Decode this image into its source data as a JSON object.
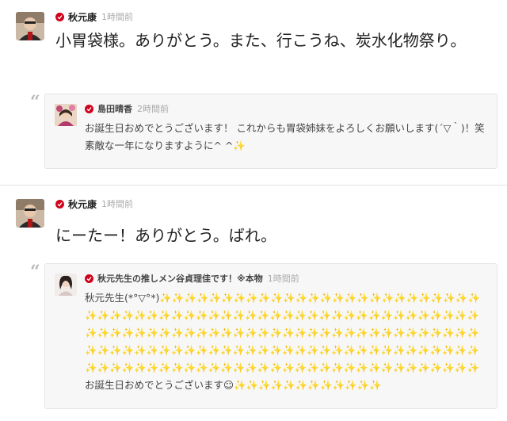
{
  "posts": [
    {
      "author": "秋元康",
      "time": "1時間前",
      "text": "小胃袋様。ありがとう。また、行こうね、炭水化物祭り。",
      "quote": {
        "author": "島田晴香",
        "time": "2時間前",
        "text": "お誕生日おめでとうございます！ これからも胃袋姉妹をよろしくお願いします(´▽｀)！笑 素敵な一年になりますように^ ^✨"
      }
    },
    {
      "author": "秋元康",
      "time": "1時間前",
      "text": "にーたー！ありがとう。ばれ。",
      "quote": {
        "author": "秋元先生の推しメン谷貞理佳です！※本物",
        "time": "1時間前",
        "text": "秋元先生(*°▽°*)✨✨✨✨✨✨✨✨✨✨✨✨✨✨✨✨✨✨✨✨✨✨✨✨✨✨✨✨✨✨✨✨✨✨✨✨✨✨✨✨✨✨✨✨✨✨✨✨✨✨✨✨✨✨✨✨✨✨✨✨✨✨✨✨✨✨✨✨✨✨✨✨✨✨✨✨✨✨✨✨✨✨✨✨✨✨✨✨✨✨✨✨✨✨✨✨✨✨✨✨✨✨✨✨✨✨✨✨✨✨✨✨✨✨✨✨✨✨✨✨✨✨✨✨✨✨✨✨✨✨✨✨✨✨✨✨✨✨✨✨✨✨✨✨✨✨✨✨✨✨✨✨✨✨お誕生日おめでとうございます☺✨✨✨✨✨✨✨✨✨✨✨✨"
      }
    }
  ],
  "icons": {
    "verified": "verified-check-icon",
    "quote": "quote-mark-icon"
  },
  "colors": {
    "verified": "#d0021b",
    "quote_bg": "#f7f7f7",
    "divider": "#e2e2e2"
  }
}
